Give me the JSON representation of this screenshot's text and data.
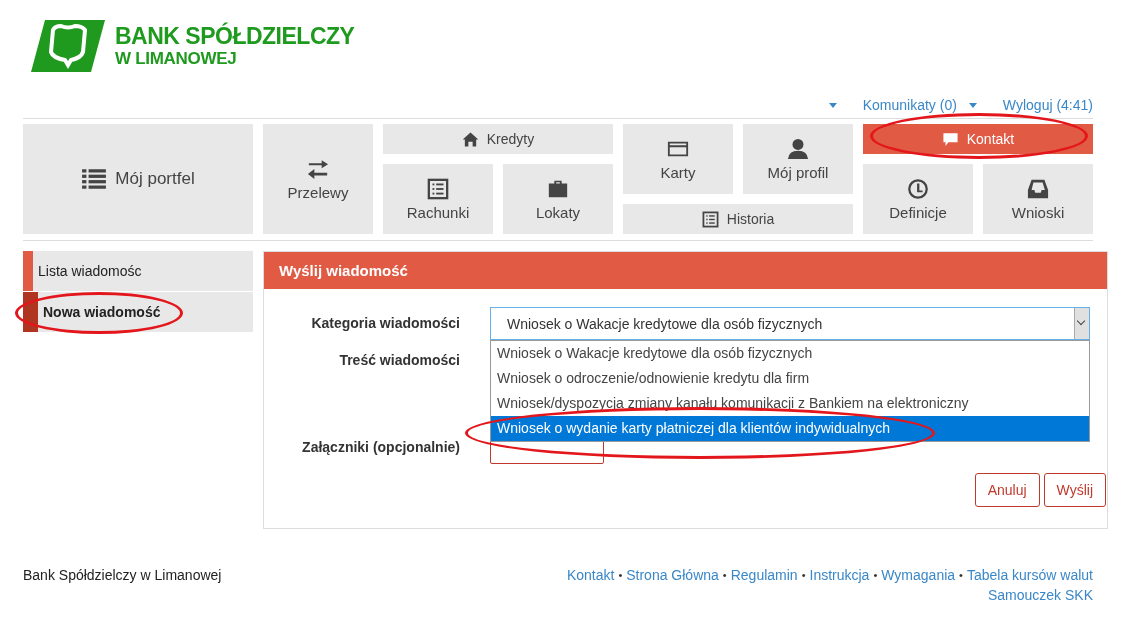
{
  "logo": {
    "line1": "BANK SPÓŁDZIELCZY",
    "line2": "W LIMANOWEJ"
  },
  "top_links": [
    {
      "label": "Komunikaty (0)"
    },
    {
      "label": "Wyloguj (4:41)"
    }
  ],
  "menu_tiles": [
    {
      "label": "Mój portfel",
      "selected": false
    },
    {
      "label": "Przelewy",
      "selected": false
    },
    {
      "label": "Kredyty",
      "selected": false
    },
    {
      "label": "Rachunki",
      "selected": false
    },
    {
      "label": "Lokaty",
      "selected": false
    },
    {
      "label": "Karty",
      "selected": false
    },
    {
      "label": "Mój profil",
      "selected": false
    },
    {
      "label": "Historia",
      "selected": false
    },
    {
      "label": "Kontakt",
      "selected": true
    },
    {
      "label": "Definicje",
      "selected": false
    },
    {
      "label": "Wnioski",
      "selected": false
    }
  ],
  "sidebar": {
    "items": [
      {
        "label": "Lista wiadomośc",
        "selected": false
      },
      {
        "label": "Nowa wiadomość",
        "selected": true
      }
    ]
  },
  "panel": {
    "title": "Wyślij wiadomość",
    "fields": [
      {
        "label": "Kategoria wiadomości"
      },
      {
        "label": "Treść wiadomości"
      },
      {
        "label": "Załączniki (opcjonalnie)"
      }
    ],
    "category_select": {
      "value": "Wniosek o Wakacje kredytowe dla osób fizycznych",
      "expanded": true,
      "options": [
        {
          "label": "Wniosek o Wakacje kredytowe dla osób fizycznych",
          "highlighted": false
        },
        {
          "label": "Wniosek o odroczenie/odnowienie kredytu dla firm",
          "highlighted": false
        },
        {
          "label": "Wniosek/dyspozycja zmiany kanału komunikacji z Bankiem na elektroniczny",
          "highlighted": false
        },
        {
          "label": "Wniosek o wydanie karty płatniczej dla klientów indywidualnych",
          "highlighted": true
        }
      ]
    },
    "buttons": [
      "Anuluj",
      "Wyślij"
    ]
  },
  "footer": {
    "bank_name": "Bank Spółdzielczy w Limanowej",
    "separator": "•",
    "links": [
      "Kontakt",
      "Strona Główna",
      "Regulamin",
      "Instrukcja",
      "Wymagania",
      "Tabela kursów walut"
    ],
    "second_line_link": "Samouczek SKK"
  }
}
